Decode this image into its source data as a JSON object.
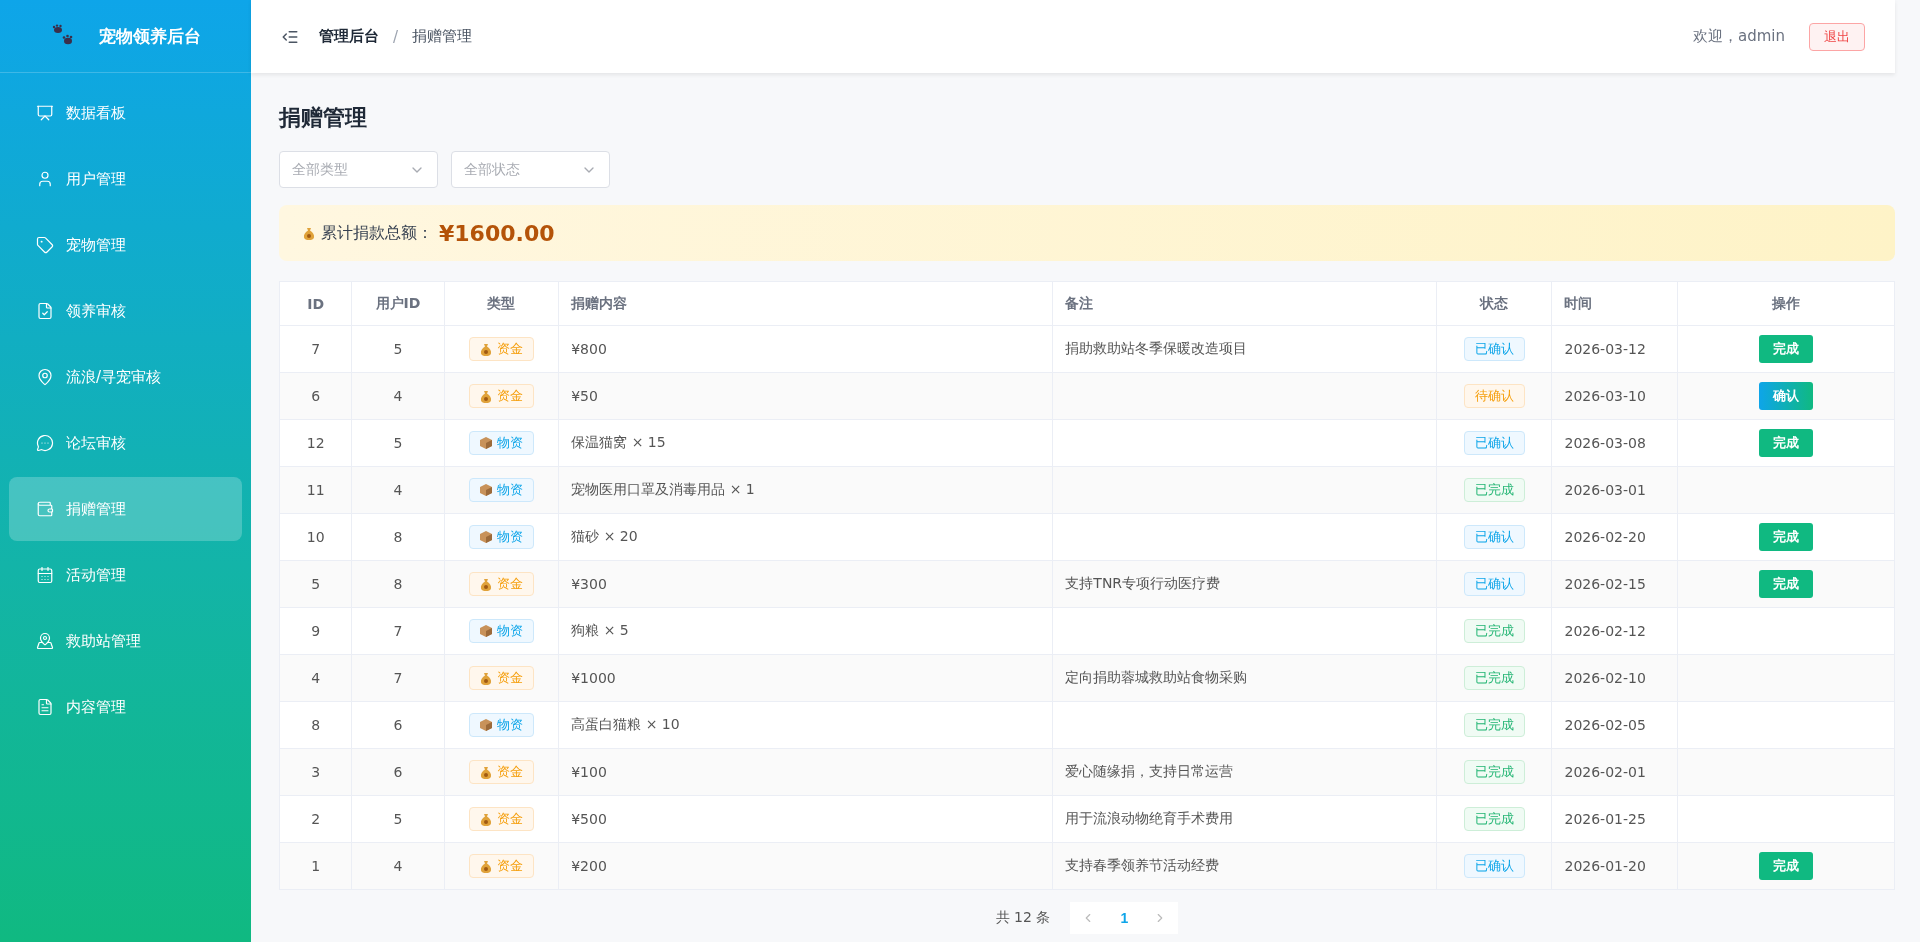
{
  "sidebar": {
    "title": "宠物领养后台",
    "items": [
      {
        "label": "数据看板",
        "selected": false
      },
      {
        "label": "用户管理",
        "selected": false
      },
      {
        "label": "宠物管理",
        "selected": false
      },
      {
        "label": "领养审核",
        "selected": false
      },
      {
        "label": "流浪/寻宠审核",
        "selected": false
      },
      {
        "label": "论坛审核",
        "selected": false
      },
      {
        "label": "捐赠管理",
        "selected": true
      },
      {
        "label": "活动管理",
        "selected": false
      },
      {
        "label": "救助站管理",
        "selected": false
      },
      {
        "label": "内容管理",
        "selected": false
      }
    ]
  },
  "header": {
    "breadcrumb": [
      "管理后台",
      "捐赠管理"
    ],
    "breadcrumb_separator": "/",
    "welcome": "欢迎，admin",
    "logout": "退出"
  },
  "page": {
    "title": "捐赠管理",
    "filters": [
      {
        "placeholder": "全部类型"
      },
      {
        "placeholder": "全部状态"
      }
    ],
    "total": {
      "label": "累计捐款总额：",
      "amount": "¥1600.00"
    },
    "table": {
      "columns": [
        "ID",
        "用户ID",
        "类型",
        "捐赠内容",
        "备注",
        "状态",
        "时间",
        "操作"
      ],
      "rows": [
        {
          "id": "7",
          "user_id": "5",
          "type": {
            "kind": "fund",
            "label": "资金"
          },
          "content": "¥800",
          "note": "捐助救助站冬季保暖改造项目",
          "status": {
            "kind": "confirmed",
            "label": "已确认"
          },
          "time": "2026-03-12",
          "action": {
            "kind": "complete",
            "label": "完成"
          }
        },
        {
          "id": "6",
          "user_id": "4",
          "type": {
            "kind": "fund",
            "label": "资金"
          },
          "content": "¥50",
          "status": {
            "kind": "pending",
            "label": "待确认"
          },
          "time": "2026-03-10",
          "action": {
            "kind": "confirm",
            "label": "确认"
          }
        },
        {
          "id": "12",
          "user_id": "5",
          "type": {
            "kind": "goods",
            "label": "物资"
          },
          "content": "保温猫窝 × 15",
          "status": {
            "kind": "confirmed",
            "label": "已确认"
          },
          "time": "2026-03-08",
          "action": {
            "kind": "complete",
            "label": "完成"
          }
        },
        {
          "id": "11",
          "user_id": "4",
          "type": {
            "kind": "goods",
            "label": "物资"
          },
          "content": "宠物医用口罩及消毒用品 × 1",
          "status": {
            "kind": "done",
            "label": "已完成"
          },
          "time": "2026-03-01"
        },
        {
          "id": "10",
          "user_id": "8",
          "type": {
            "kind": "goods",
            "label": "物资"
          },
          "content": "猫砂 × 20",
          "status": {
            "kind": "confirmed",
            "label": "已确认"
          },
          "time": "2026-02-20",
          "action": {
            "kind": "complete",
            "label": "完成"
          }
        },
        {
          "id": "5",
          "user_id": "8",
          "type": {
            "kind": "fund",
            "label": "资金"
          },
          "content": "¥300",
          "note": "支持TNR专项行动医疗费",
          "status": {
            "kind": "confirmed",
            "label": "已确认"
          },
          "time": "2026-02-15",
          "action": {
            "kind": "complete",
            "label": "完成"
          }
        },
        {
          "id": "9",
          "user_id": "7",
          "type": {
            "kind": "goods",
            "label": "物资"
          },
          "content": "狗粮 × 5",
          "status": {
            "kind": "done",
            "label": "已完成"
          },
          "time": "2026-02-12"
        },
        {
          "id": "4",
          "user_id": "7",
          "type": {
            "kind": "fund",
            "label": "资金"
          },
          "content": "¥1000",
          "note": "定向捐助蓉城救助站食物采购",
          "status": {
            "kind": "done",
            "label": "已完成"
          },
          "time": "2026-02-10"
        },
        {
          "id": "8",
          "user_id": "6",
          "type": {
            "kind": "goods",
            "label": "物资"
          },
          "content": "高蛋白猫粮 × 10",
          "status": {
            "kind": "done",
            "label": "已完成"
          },
          "time": "2026-02-05"
        },
        {
          "id": "3",
          "user_id": "6",
          "type": {
            "kind": "fund",
            "label": "资金"
          },
          "content": "¥100",
          "note": "爱心随缘捐，支持日常运营",
          "status": {
            "kind": "done",
            "label": "已完成"
          },
          "time": "2026-02-01"
        },
        {
          "id": "2",
          "user_id": "5",
          "type": {
            "kind": "fund",
            "label": "资金"
          },
          "content": "¥500",
          "note": "用于流浪动物绝育手术费用",
          "status": {
            "kind": "done",
            "label": "已完成"
          },
          "time": "2026-01-25"
        },
        {
          "id": "1",
          "user_id": "4",
          "type": {
            "kind": "fund",
            "label": "资金"
          },
          "content": "¥200",
          "note": "支持春季领养节活动经费",
          "status": {
            "kind": "confirmed",
            "label": "已确认"
          },
          "time": "2026-01-20",
          "action": {
            "kind": "complete",
            "label": "完成"
          }
        }
      ]
    },
    "pagination": {
      "total": "共 12 条",
      "pages": [
        {
          "label": "1",
          "selected": true
        }
      ]
    }
  }
}
